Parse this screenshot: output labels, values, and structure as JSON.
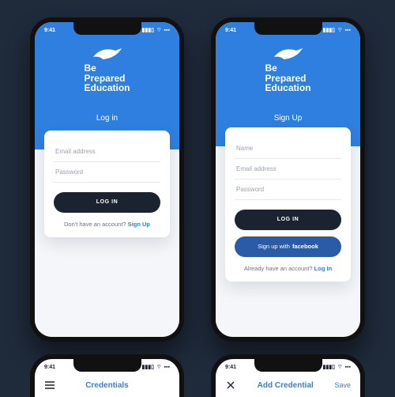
{
  "status": {
    "time": "9:41",
    "signal": "▮▮▮▯",
    "wifi": "⌔",
    "battery": "▪▪▪"
  },
  "brand": {
    "line1": "Be",
    "line2": "Prepared",
    "line3": "Education"
  },
  "left": {
    "hero_title": "Log in",
    "fields": {
      "email": "Email address",
      "password": "Password"
    },
    "primary_btn": "LOG IN",
    "footer_text": "Don't have an account? ",
    "footer_link": "Sign Up"
  },
  "right": {
    "hero_title": "Sign Up",
    "fields": {
      "name": "Name",
      "email": "Email address",
      "password": "Password"
    },
    "primary_btn": "LOG IN",
    "fb_prefix": "Sign up with ",
    "fb_bold": "facebook",
    "footer_text": "Already have an account? ",
    "footer_link": "Log In"
  },
  "bottom_left": {
    "nav_icon": "hamburger",
    "title": "Credentials",
    "action": ""
  },
  "bottom_right": {
    "nav_icon": "close",
    "title": "Add Credential",
    "action": "Save"
  }
}
